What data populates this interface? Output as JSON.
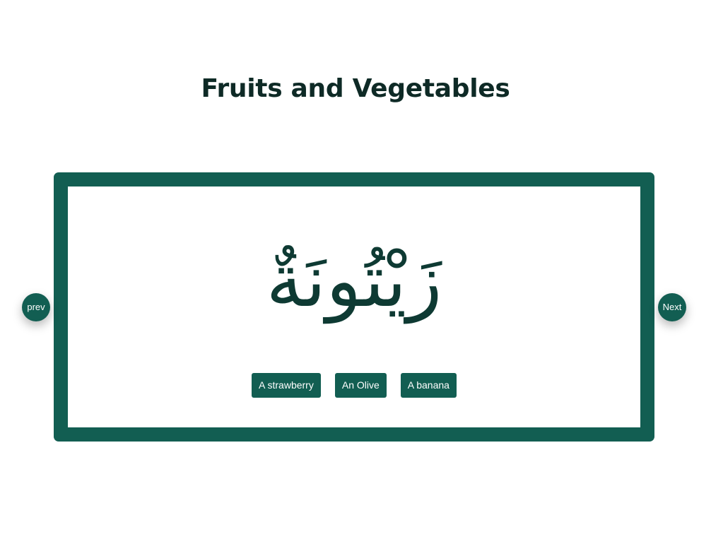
{
  "page": {
    "title": "Fruits and Vegetables"
  },
  "card": {
    "word": "زَيْتُونَةٌ",
    "options": [
      {
        "label": "A strawberry"
      },
      {
        "label": "An Olive"
      },
      {
        "label": "A banana"
      }
    ]
  },
  "navigation": {
    "prev_label": "prev",
    "next_label": "Next"
  },
  "colors": {
    "accent": "#125e52",
    "title_text": "#0e2a26",
    "word_text": "#0e3a33",
    "background": "#ffffff"
  }
}
